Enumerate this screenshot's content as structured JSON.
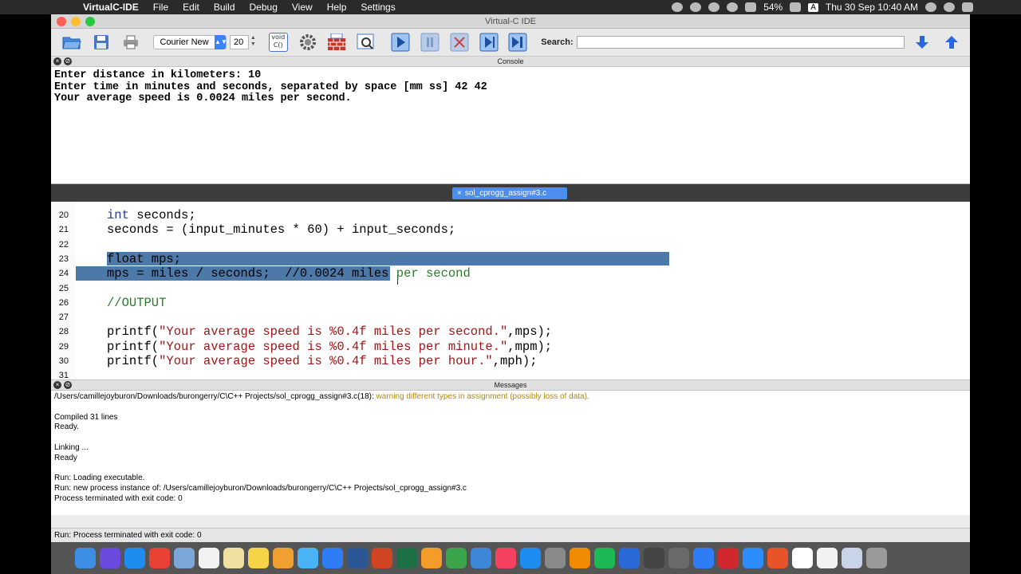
{
  "menubar": {
    "app_name": "VirtualC-IDE",
    "items": [
      "File",
      "Edit",
      "Build",
      "Debug",
      "View",
      "Help",
      "Settings"
    ],
    "battery": "54%",
    "input_source": "A",
    "datetime": "Thu 30 Sep  10:40 AM"
  },
  "window": {
    "title": "Virtual-C IDE"
  },
  "toolbar": {
    "font_name": "Courier New",
    "font_size": "20",
    "search_label": "Search:",
    "search_value": "",
    "void_icon_text": "void C()"
  },
  "console": {
    "title": "Console",
    "lines": [
      "Enter distance in kilometers: 10",
      "Enter time in minutes and seconds, separated by space [mm ss] 42 42",
      "Your average speed is 0.0024 miles per second."
    ]
  },
  "editor": {
    "tab_close": "×",
    "tab_label": "sol_cprogg_assign#3.c",
    "lines": [
      {
        "num": "20",
        "parts": [
          [
            "kw",
            "int"
          ],
          [
            "",
            " seconds;"
          ]
        ]
      },
      {
        "num": "21",
        "parts": [
          [
            "",
            "seconds = (input_minutes * 60) + input_seconds;"
          ]
        ]
      },
      {
        "num": "22",
        "parts": []
      },
      {
        "num": "23",
        "parts": [
          [
            "",
            "float mps;"
          ]
        ]
      },
      {
        "num": "24",
        "parts": [
          [
            "",
            "mps = miles / seconds;  //0.0024 miles"
          ],
          [
            "cmt",
            " per second"
          ]
        ]
      },
      {
        "num": "25",
        "parts": []
      },
      {
        "num": "26",
        "parts": [
          [
            "cmt",
            "//OUTPUT"
          ]
        ]
      },
      {
        "num": "27",
        "parts": []
      },
      {
        "num": "28",
        "parts": [
          [
            "",
            "printf("
          ],
          [
            "str",
            "\"Your average speed is %0.4f miles per second.\""
          ],
          [
            "",
            ",mps);"
          ]
        ]
      },
      {
        "num": "29",
        "parts": [
          [
            "",
            "printf("
          ],
          [
            "str",
            "\"Your average speed is %0.4f miles per minute.\""
          ],
          [
            "",
            ",mpm);"
          ]
        ]
      },
      {
        "num": "30",
        "parts": [
          [
            "",
            "printf("
          ],
          [
            "str",
            "\"Your average speed is %0.4f miles per hour.\""
          ],
          [
            "",
            ",mph);"
          ]
        ]
      },
      {
        "num": "31",
        "parts": []
      }
    ]
  },
  "messages": {
    "title": "Messages",
    "warning_path": "/Users/camillejoyburon/Downloads/burongerry/C\\C++ Projects/sol_cprogg_assign#3.c(18):",
    "warning_text": "warning different types in assignment (possibly loss of data).",
    "compiled": "Compiled 31 lines",
    "ready1": "Ready.",
    "linking": "Linking ...",
    "ready2": "Ready",
    "run_loading": "Run: Loading executable.",
    "run_instance": "Run: new process instance of: /Users/camillejoyburon/Downloads/burongerry/C\\C++ Projects/sol_cprogg_assign#3.c",
    "terminated": "Process terminated with exit code: 0"
  },
  "statusbar": {
    "text": "Run: Process terminated with exit code: 0"
  },
  "dock": {
    "icons": [
      {
        "name": "finder-icon",
        "color": "#3d8fe6"
      },
      {
        "name": "siri-icon",
        "color": "#6b4ae0"
      },
      {
        "name": "safari-icon",
        "color": "#1f8cf0"
      },
      {
        "name": "chrome-icon",
        "color": "#e94235"
      },
      {
        "name": "preview-icon",
        "color": "#7aa7d8"
      },
      {
        "name": "calendar-icon",
        "color": "#f2f2f2"
      },
      {
        "name": "notes-stack-icon",
        "color": "#f0e0a0"
      },
      {
        "name": "notes-icon",
        "color": "#f5d547"
      },
      {
        "name": "photos-icon",
        "color": "#f0a030"
      },
      {
        "name": "messages-icon",
        "color": "#4ab3f5"
      },
      {
        "name": "messenger-icon",
        "color": "#2e7cf6"
      },
      {
        "name": "word-icon",
        "color": "#2b5797"
      },
      {
        "name": "powerpoint-icon",
        "color": "#d04423"
      },
      {
        "name": "excel-icon",
        "color": "#1e7145"
      },
      {
        "name": "pages-icon",
        "color": "#f49b2a"
      },
      {
        "name": "numbers-icon",
        "color": "#3aa54a"
      },
      {
        "name": "keynote-icon",
        "color": "#3e86d8"
      },
      {
        "name": "music-icon",
        "color": "#f64260"
      },
      {
        "name": "appstore-icon",
        "color": "#1d8cf0"
      },
      {
        "name": "system-preferences-icon",
        "color": "#8a8a8a"
      },
      {
        "name": "vlc-icon",
        "color": "#f08a00"
      },
      {
        "name": "spotify-icon",
        "color": "#1db954"
      },
      {
        "name": "vpn-icon",
        "color": "#2a6ad8"
      },
      {
        "name": "screenshot-icon",
        "color": "#444444"
      },
      {
        "name": "image-capture-icon",
        "color": "#6a6a6a"
      },
      {
        "name": "bluetooth-icon",
        "color": "#2e7cf6"
      },
      {
        "name": "acrobat-icon",
        "color": "#d0282c"
      },
      {
        "name": "zoom-icon",
        "color": "#2d8cff"
      },
      {
        "name": "office-icon",
        "color": "#e8542a"
      },
      {
        "name": "virtualc-icon",
        "color": "#ffffff"
      },
      {
        "name": "textedit-icon",
        "color": "#f2f2f2"
      },
      {
        "name": "documents-icon",
        "color": "#c8d4e8"
      },
      {
        "name": "trash-icon",
        "color": "#9a9a9a"
      }
    ]
  }
}
